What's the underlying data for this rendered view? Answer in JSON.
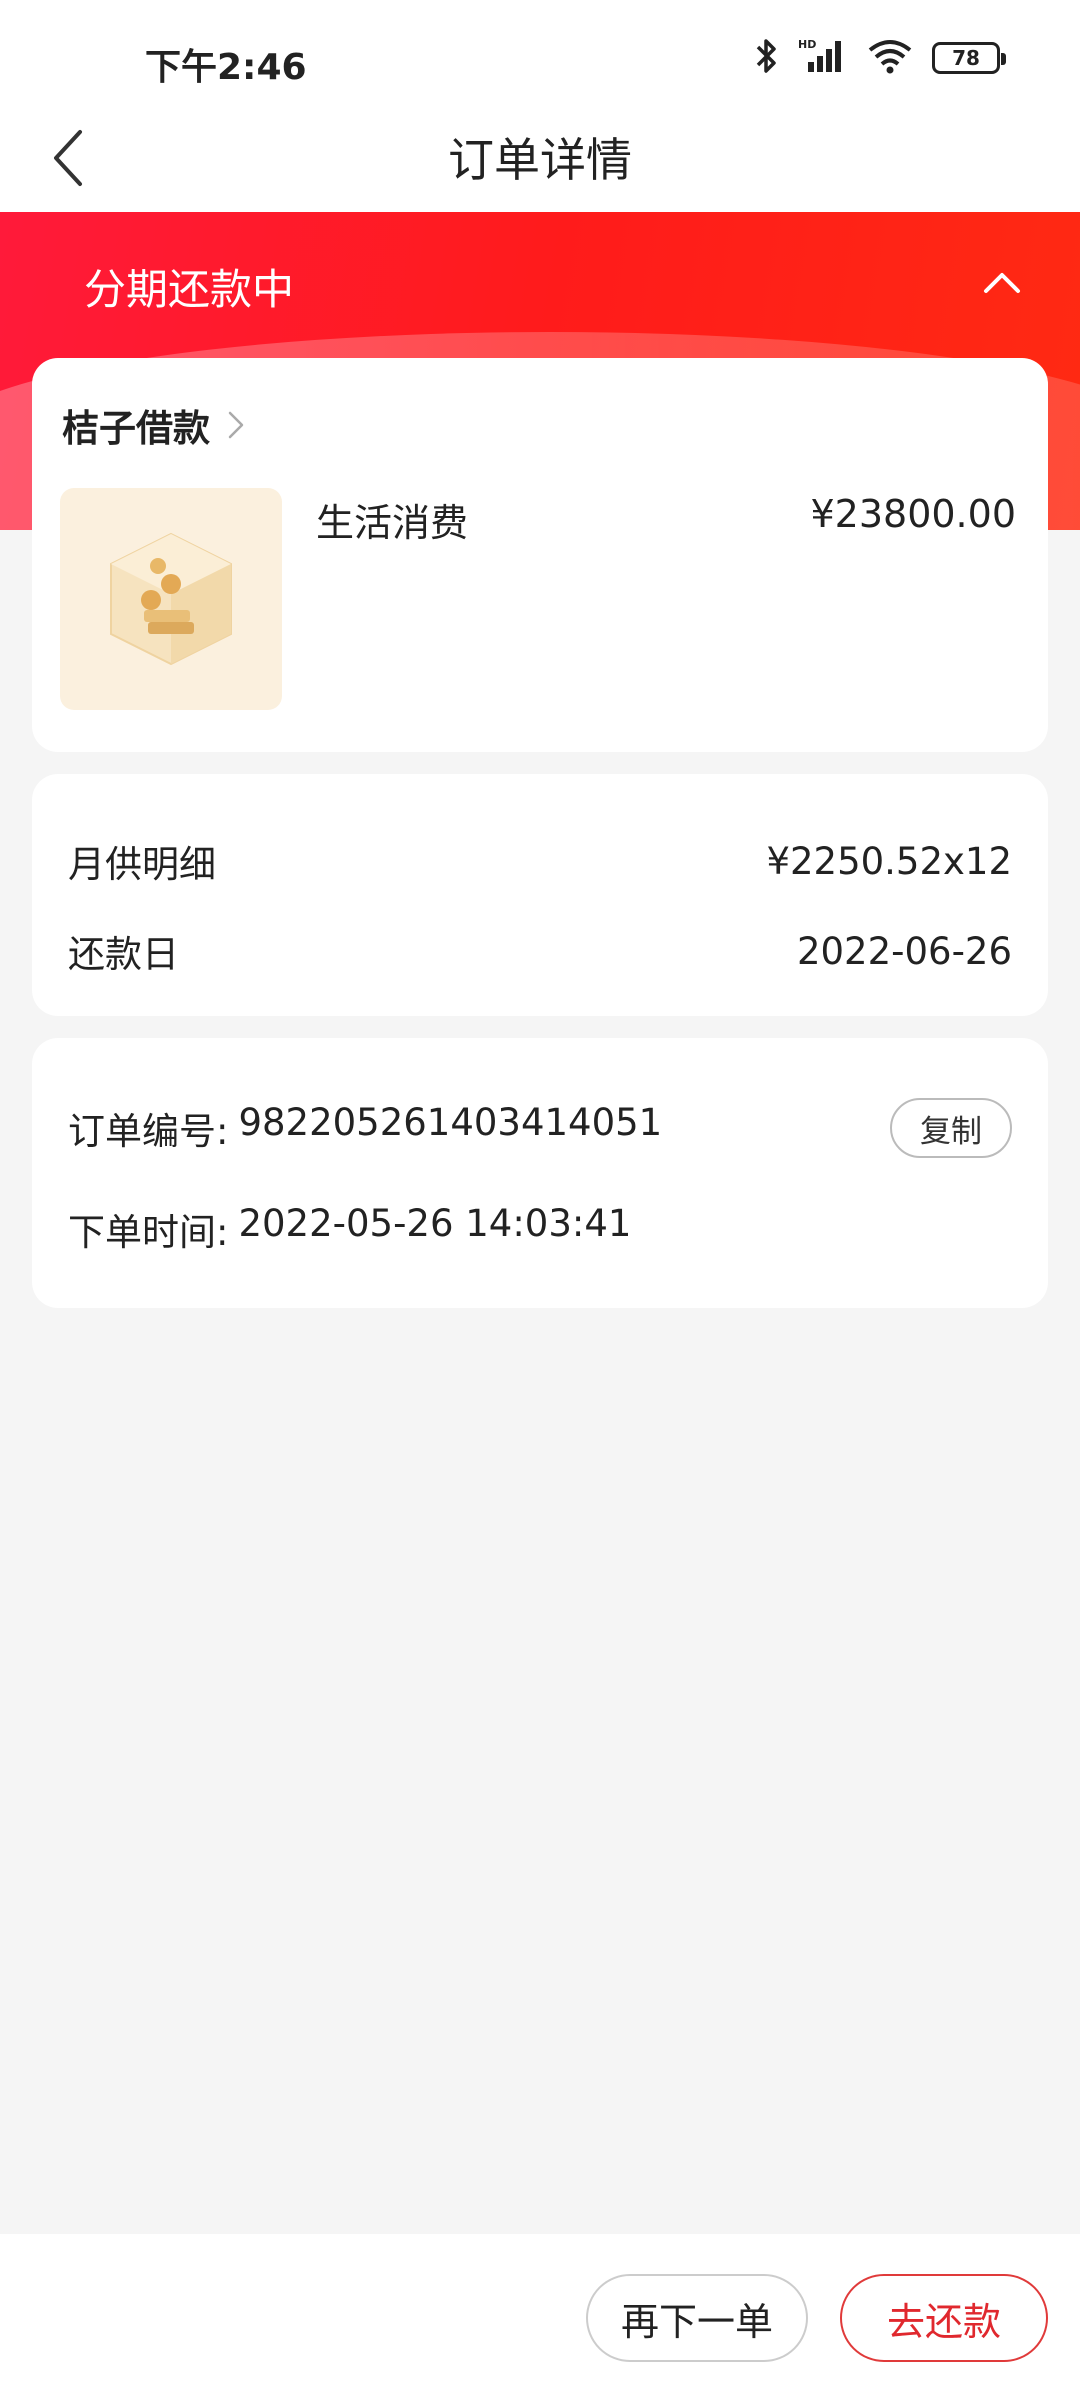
{
  "status_bar": {
    "time": "下午2:46",
    "battery": "78",
    "icons": [
      "bluetooth-icon",
      "hd-signal-icon",
      "wifi-icon",
      "battery-icon"
    ]
  },
  "header": {
    "title": "订单详情"
  },
  "banner": {
    "status": "分期还款中",
    "color": "#ff1b1b"
  },
  "product": {
    "merchant": "桔子借款",
    "name": "生活消费",
    "price": "¥23800.00"
  },
  "schedule": {
    "monthly_label": "月供明细",
    "monthly_value": "¥2250.52x12",
    "due_label": "还款日",
    "due_value": "2022-06-26"
  },
  "order": {
    "number_label": "订单编号:",
    "number_value": "982205261403414051",
    "copy_label": "复制",
    "time_label": "下单时间:",
    "time_value": "2022-05-26 14:03:41"
  },
  "actions": {
    "reorder_label": "再下一单",
    "repay_label": "去还款",
    "accent": "#e0282e"
  }
}
